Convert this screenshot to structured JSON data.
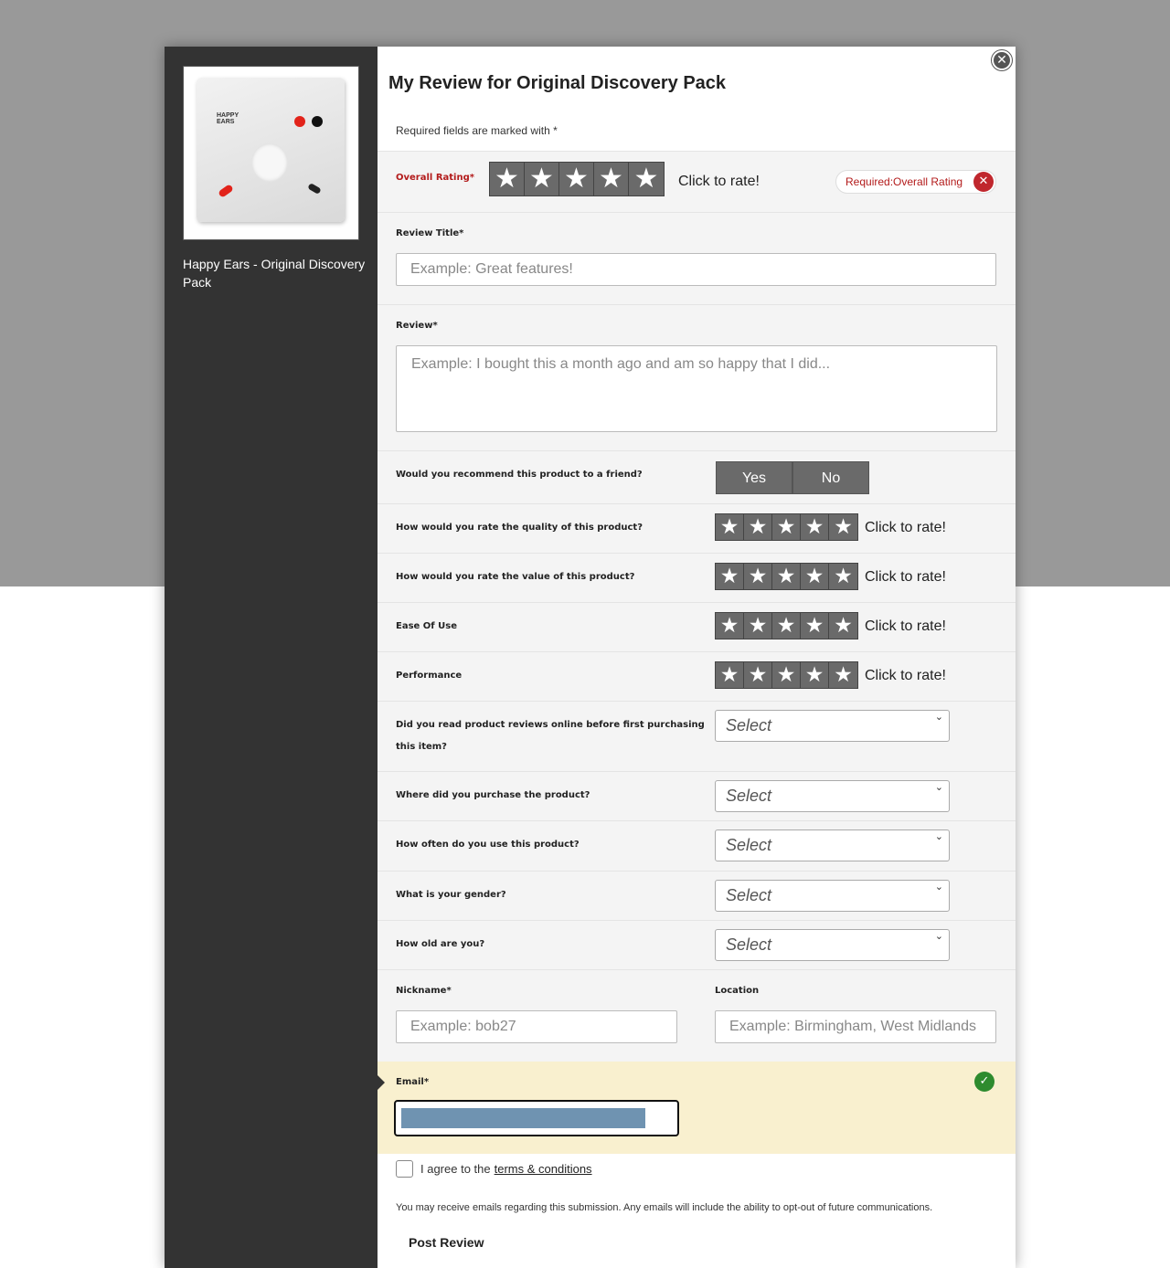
{
  "product": {
    "name": "Happy Ears - Original Discovery Pack",
    "pack_logo": "HAPPY EARS"
  },
  "modal": {
    "title": "My Review for Original Discovery Pack",
    "required_note": "Required fields are marked with *"
  },
  "overall_rating": {
    "label": "Overall Rating*",
    "click_text": "Click to rate!",
    "required_badge": "Required:Overall Rating"
  },
  "review_title": {
    "label": "Review Title*",
    "placeholder": "Example: Great features!"
  },
  "review": {
    "label": "Review*",
    "placeholder": "Example: I bought this a month ago and am so happy that I did..."
  },
  "recommend": {
    "label": "Would you recommend this product to a friend?",
    "yes": "Yes",
    "no": "No"
  },
  "ratings": [
    {
      "label": "How would you rate the quality of this product?",
      "click_text": "Click to rate!"
    },
    {
      "label": "How would you rate the value of this product?",
      "click_text": "Click to rate!"
    },
    {
      "label": "Ease Of Use",
      "click_text": "Click to rate!"
    },
    {
      "label": "Performance",
      "click_text": "Click to rate!"
    }
  ],
  "selects": [
    {
      "label_line1": "Did you read product reviews online before first purchasing",
      "label_line2": "this item?",
      "value": "Select"
    },
    {
      "label": "Where did you purchase the product?",
      "value": "Select"
    },
    {
      "label": "How often do you use this product?",
      "value": "Select"
    },
    {
      "label": "What is your gender?",
      "value": "Select"
    },
    {
      "label": "How old are you?",
      "value": "Select"
    }
  ],
  "nickname": {
    "label": "Nickname*",
    "placeholder": "Example: bob27"
  },
  "location": {
    "label": "Location",
    "placeholder": "Example: Birmingham, West Midlands"
  },
  "email": {
    "label": "Email*"
  },
  "terms": {
    "prefix": "I agree to the",
    "link": "terms & conditions"
  },
  "disclaimer": "You may receive emails regarding this submission. Any emails will include the ability to opt-out of future communications.",
  "post_button": "Post Review",
  "icons": {
    "close": "close-icon",
    "error": "error-icon",
    "check": "check-icon",
    "star": "star-icon",
    "chevron": "chevron-down-icon"
  },
  "colors": {
    "sidebar": "#333333",
    "overlay": "#999999",
    "error": "#c0272d",
    "success": "#2e8b2e",
    "email_highlight": "#f9f0cf"
  }
}
